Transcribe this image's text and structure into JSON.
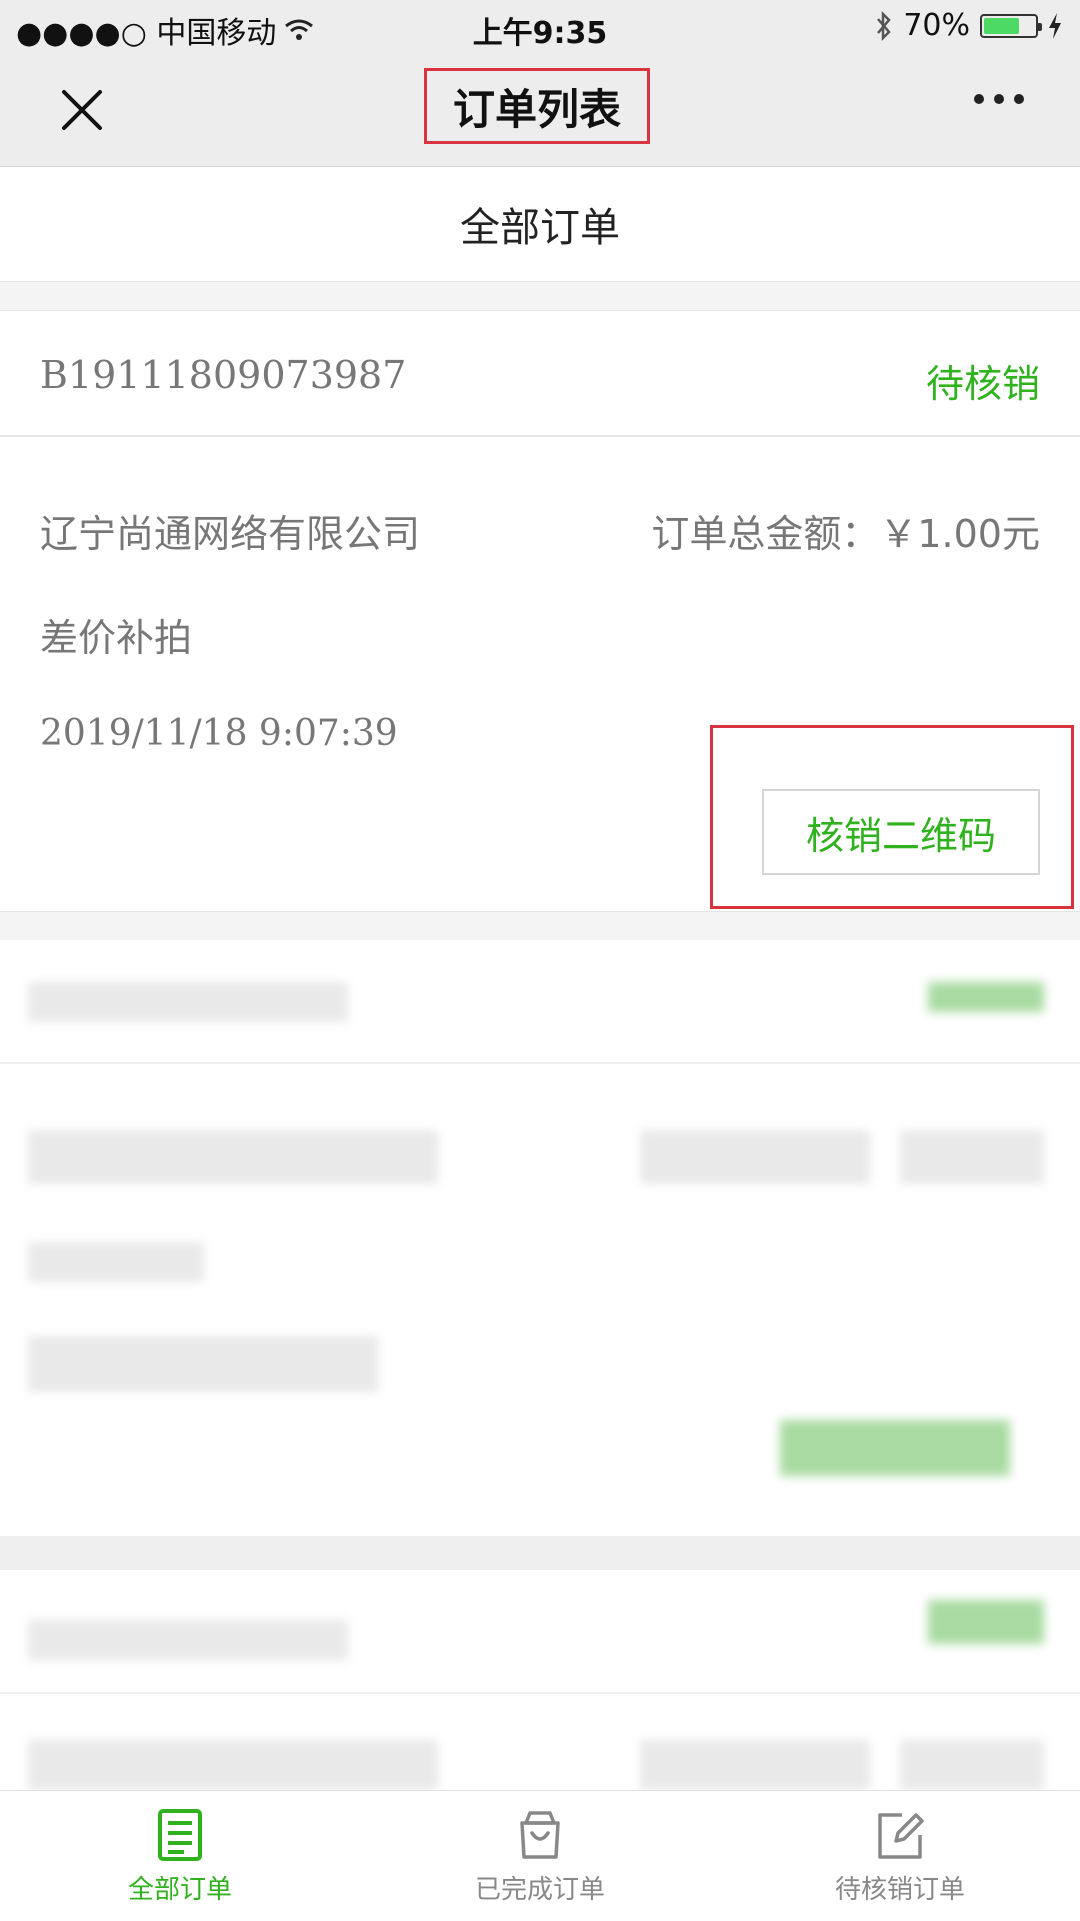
{
  "status_bar": {
    "carrier": "●●●●○ 中国移动",
    "time": "上午9:35",
    "battery_percent": "70%",
    "battery_level": 0.7
  },
  "nav": {
    "title": "订单列表"
  },
  "tab_header": {
    "label": "全部订单"
  },
  "order": {
    "id": "B19111809073987",
    "status": "待核销",
    "company": "辽宁尚通网络有限公司",
    "total": "订单总金额：￥1.00元",
    "product": "差价补拍",
    "time": "2019/11/18 9:07:39",
    "qr_button": "核销二维码"
  },
  "tab_bar": {
    "items": [
      {
        "label": "全部订单",
        "icon": "document-list-icon",
        "active": true
      },
      {
        "label": "已完成订单",
        "icon": "shopping-bag-icon",
        "active": false
      },
      {
        "label": "待核销订单",
        "icon": "edit-icon",
        "active": false
      }
    ]
  },
  "colors": {
    "accent_green": "#2fb21e",
    "highlight_red": "#d9333f"
  }
}
